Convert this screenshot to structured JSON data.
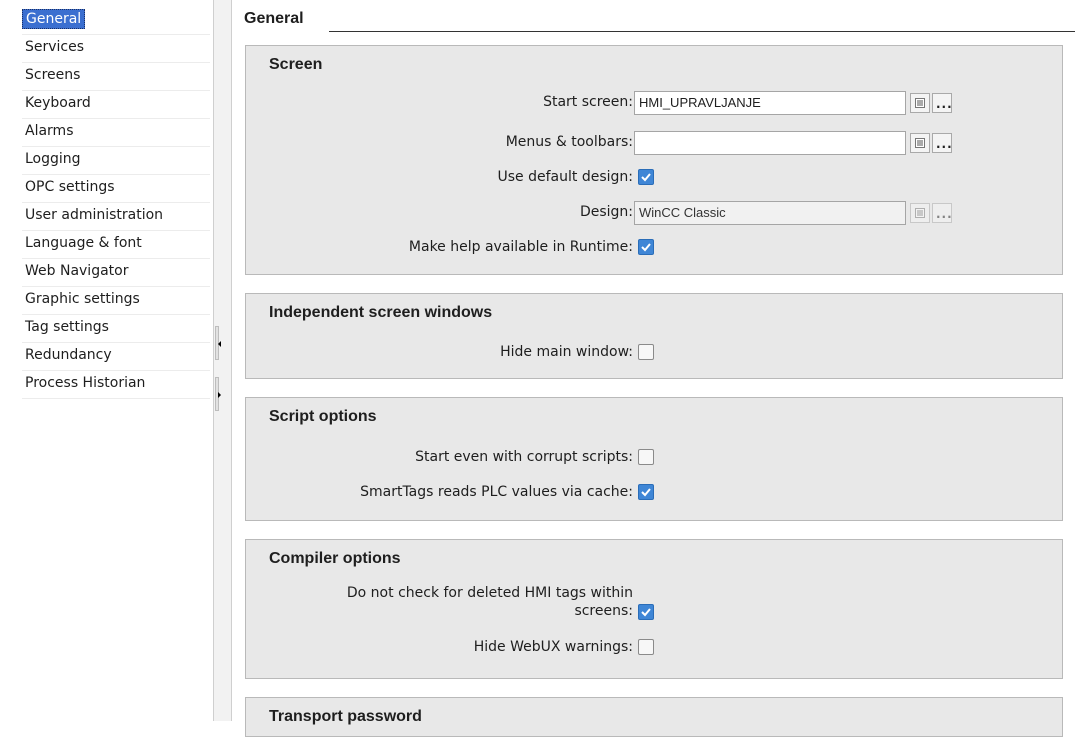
{
  "sidebar": {
    "items": [
      {
        "label": "General"
      },
      {
        "label": "Services"
      },
      {
        "label": "Screens"
      },
      {
        "label": "Keyboard"
      },
      {
        "label": "Alarms"
      },
      {
        "label": "Logging"
      },
      {
        "label": "OPC settings"
      },
      {
        "label": "User administration"
      },
      {
        "label": "Language & font"
      },
      {
        "label": "Web Navigator"
      },
      {
        "label": "Graphic settings"
      },
      {
        "label": "Tag settings"
      },
      {
        "label": "Redundancy"
      },
      {
        "label": "Process Historian"
      }
    ],
    "active_item": "General"
  },
  "main": {
    "title": "General",
    "screen": {
      "title": "Screen",
      "start_screen_label": "Start screen:",
      "start_screen_value": "HMI_UPRAVLJANJE",
      "menus_toolbars_label": "Menus & toolbars:",
      "menus_toolbars_value": "",
      "use_default_design_label": "Use default design:",
      "use_default_design_checked": true,
      "design_label": "Design:",
      "design_value": "WinCC Classic",
      "make_help_label": "Make help available in Runtime:",
      "make_help_checked": true
    },
    "independent": {
      "title": "Independent screen windows",
      "hide_main_window_label": "Hide main window:",
      "hide_main_window_checked": false
    },
    "script": {
      "title": "Script options",
      "start_corrupt_label": "Start even with corrupt scripts:",
      "start_corrupt_checked": false,
      "smarttags_label": "SmartTags reads PLC values via cache:",
      "smarttags_checked": true
    },
    "compiler": {
      "title": "Compiler options",
      "no_check_label_line1": "Do not check for deleted HMI tags within",
      "no_check_label_line2": "screens:",
      "no_check_checked": true,
      "hide_webux_label": "Hide WebUX warnings:",
      "hide_webux_checked": false
    },
    "transport": {
      "title": "Transport password"
    }
  },
  "buttons": {
    "browse_label": "..."
  },
  "colors": {
    "accent": "#3b6fd0",
    "checkbox_checked": "#3f86d6",
    "section_bg": "#e8e8e8"
  }
}
